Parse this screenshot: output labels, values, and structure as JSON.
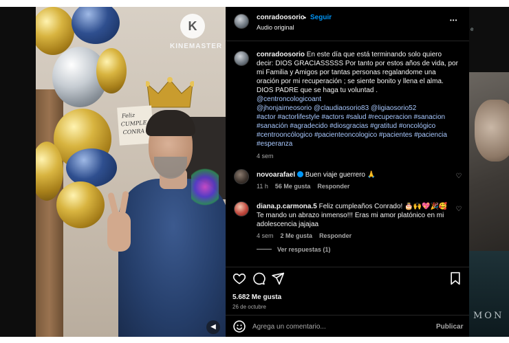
{
  "kinemaster": {
    "logo_letter": "K",
    "brand": "KINEMASTER"
  },
  "sign": {
    "line1": "Feliz",
    "line2": "CUMPLE",
    "line3": "CONRA"
  },
  "right_overlay": {
    "bottom_text": "MON",
    "top_small": "e"
  },
  "header": {
    "username": "conradoosorio",
    "separator": "•",
    "follow": "Seguir",
    "subtitle": "Audio original",
    "more": "•••"
  },
  "caption": {
    "username": "conradoosorio",
    "text": "En este día que está terminando solo quiero decir: DIOS GRACIASSSSS Por tanto por estos años de vida, por mi Familia y Amigos por tantas personas regalandome una oración por mi recuperación ; se siente bonito y llena el alma. DIOS PADRE que se haga tu voluntad .",
    "mention1": "@centroncologicoant",
    "mentions2": [
      "@jhonjaimeosorio",
      "@claudiaosorio83",
      "@ligiaosorio52"
    ],
    "tags": [
      "#actor",
      "#actorlifestyle",
      "#actors",
      "#salud",
      "#recuperacion",
      "#sanacion",
      "#sanación",
      "#agradecido",
      "#diosgracias",
      "#gratitud",
      "#oncológico",
      "#centrooncólogico",
      "#pacienteoncologico",
      "#pacientes",
      "#paciencia",
      "#esperanza"
    ],
    "time": "4 sem"
  },
  "comments": [
    {
      "username": "novoarafael",
      "verified": true,
      "text": "Buen viaje guerrero 🙏",
      "time": "11 h",
      "likes": "56 Me gusta",
      "reply": "Responder"
    },
    {
      "username": "diana.p.carmona.5",
      "text_line1": "Feliz cumpleaños Conrado! 🎂🙌💖🎉🥰",
      "text_line2": "Te mando un abrazo inmenso!!! Eras mi amor platónico en mi",
      "text_line3": "adolescencia jajajaa",
      "time": "4 sem",
      "likes": "2 Me gusta",
      "reply": "Responder",
      "view_replies": "Ver respuestas (1)"
    }
  ],
  "actions": {
    "likes": "5.682 Me gusta",
    "date": "26 de octubre"
  },
  "add_comment": {
    "placeholder": "Agrega un comentario...",
    "publish": "Publicar"
  }
}
